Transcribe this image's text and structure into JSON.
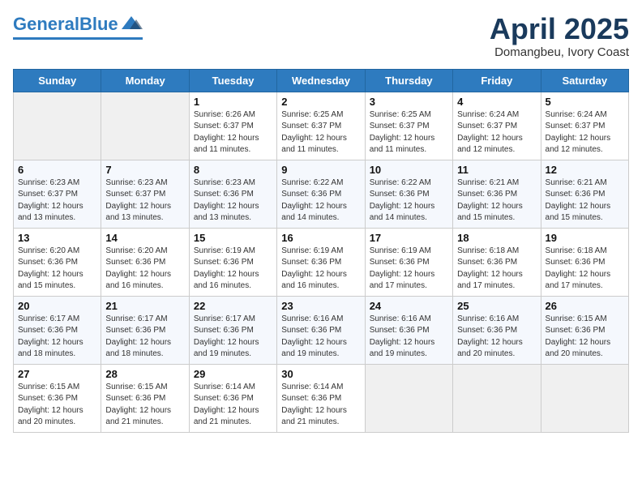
{
  "header": {
    "logo_line1": "General",
    "logo_line2": "Blue",
    "title": "April 2025",
    "subtitle": "Domangbeu, Ivory Coast"
  },
  "weekdays": [
    "Sunday",
    "Monday",
    "Tuesday",
    "Wednesday",
    "Thursday",
    "Friday",
    "Saturday"
  ],
  "weeks": [
    [
      {
        "day": "",
        "info": ""
      },
      {
        "day": "",
        "info": ""
      },
      {
        "day": "1",
        "info": "Sunrise: 6:26 AM\nSunset: 6:37 PM\nDaylight: 12 hours\nand 11 minutes."
      },
      {
        "day": "2",
        "info": "Sunrise: 6:25 AM\nSunset: 6:37 PM\nDaylight: 12 hours\nand 11 minutes."
      },
      {
        "day": "3",
        "info": "Sunrise: 6:25 AM\nSunset: 6:37 PM\nDaylight: 12 hours\nand 11 minutes."
      },
      {
        "day": "4",
        "info": "Sunrise: 6:24 AM\nSunset: 6:37 PM\nDaylight: 12 hours\nand 12 minutes."
      },
      {
        "day": "5",
        "info": "Sunrise: 6:24 AM\nSunset: 6:37 PM\nDaylight: 12 hours\nand 12 minutes."
      }
    ],
    [
      {
        "day": "6",
        "info": "Sunrise: 6:23 AM\nSunset: 6:37 PM\nDaylight: 12 hours\nand 13 minutes."
      },
      {
        "day": "7",
        "info": "Sunrise: 6:23 AM\nSunset: 6:37 PM\nDaylight: 12 hours\nand 13 minutes."
      },
      {
        "day": "8",
        "info": "Sunrise: 6:23 AM\nSunset: 6:36 PM\nDaylight: 12 hours\nand 13 minutes."
      },
      {
        "day": "9",
        "info": "Sunrise: 6:22 AM\nSunset: 6:36 PM\nDaylight: 12 hours\nand 14 minutes."
      },
      {
        "day": "10",
        "info": "Sunrise: 6:22 AM\nSunset: 6:36 PM\nDaylight: 12 hours\nand 14 minutes."
      },
      {
        "day": "11",
        "info": "Sunrise: 6:21 AM\nSunset: 6:36 PM\nDaylight: 12 hours\nand 15 minutes."
      },
      {
        "day": "12",
        "info": "Sunrise: 6:21 AM\nSunset: 6:36 PM\nDaylight: 12 hours\nand 15 minutes."
      }
    ],
    [
      {
        "day": "13",
        "info": "Sunrise: 6:20 AM\nSunset: 6:36 PM\nDaylight: 12 hours\nand 15 minutes."
      },
      {
        "day": "14",
        "info": "Sunrise: 6:20 AM\nSunset: 6:36 PM\nDaylight: 12 hours\nand 16 minutes."
      },
      {
        "day": "15",
        "info": "Sunrise: 6:19 AM\nSunset: 6:36 PM\nDaylight: 12 hours\nand 16 minutes."
      },
      {
        "day": "16",
        "info": "Sunrise: 6:19 AM\nSunset: 6:36 PM\nDaylight: 12 hours\nand 16 minutes."
      },
      {
        "day": "17",
        "info": "Sunrise: 6:19 AM\nSunset: 6:36 PM\nDaylight: 12 hours\nand 17 minutes."
      },
      {
        "day": "18",
        "info": "Sunrise: 6:18 AM\nSunset: 6:36 PM\nDaylight: 12 hours\nand 17 minutes."
      },
      {
        "day": "19",
        "info": "Sunrise: 6:18 AM\nSunset: 6:36 PM\nDaylight: 12 hours\nand 17 minutes."
      }
    ],
    [
      {
        "day": "20",
        "info": "Sunrise: 6:17 AM\nSunset: 6:36 PM\nDaylight: 12 hours\nand 18 minutes."
      },
      {
        "day": "21",
        "info": "Sunrise: 6:17 AM\nSunset: 6:36 PM\nDaylight: 12 hours\nand 18 minutes."
      },
      {
        "day": "22",
        "info": "Sunrise: 6:17 AM\nSunset: 6:36 PM\nDaylight: 12 hours\nand 19 minutes."
      },
      {
        "day": "23",
        "info": "Sunrise: 6:16 AM\nSunset: 6:36 PM\nDaylight: 12 hours\nand 19 minutes."
      },
      {
        "day": "24",
        "info": "Sunrise: 6:16 AM\nSunset: 6:36 PM\nDaylight: 12 hours\nand 19 minutes."
      },
      {
        "day": "25",
        "info": "Sunrise: 6:16 AM\nSunset: 6:36 PM\nDaylight: 12 hours\nand 20 minutes."
      },
      {
        "day": "26",
        "info": "Sunrise: 6:15 AM\nSunset: 6:36 PM\nDaylight: 12 hours\nand 20 minutes."
      }
    ],
    [
      {
        "day": "27",
        "info": "Sunrise: 6:15 AM\nSunset: 6:36 PM\nDaylight: 12 hours\nand 20 minutes."
      },
      {
        "day": "28",
        "info": "Sunrise: 6:15 AM\nSunset: 6:36 PM\nDaylight: 12 hours\nand 21 minutes."
      },
      {
        "day": "29",
        "info": "Sunrise: 6:14 AM\nSunset: 6:36 PM\nDaylight: 12 hours\nand 21 minutes."
      },
      {
        "day": "30",
        "info": "Sunrise: 6:14 AM\nSunset: 6:36 PM\nDaylight: 12 hours\nand 21 minutes."
      },
      {
        "day": "",
        "info": ""
      },
      {
        "day": "",
        "info": ""
      },
      {
        "day": "",
        "info": ""
      }
    ]
  ]
}
